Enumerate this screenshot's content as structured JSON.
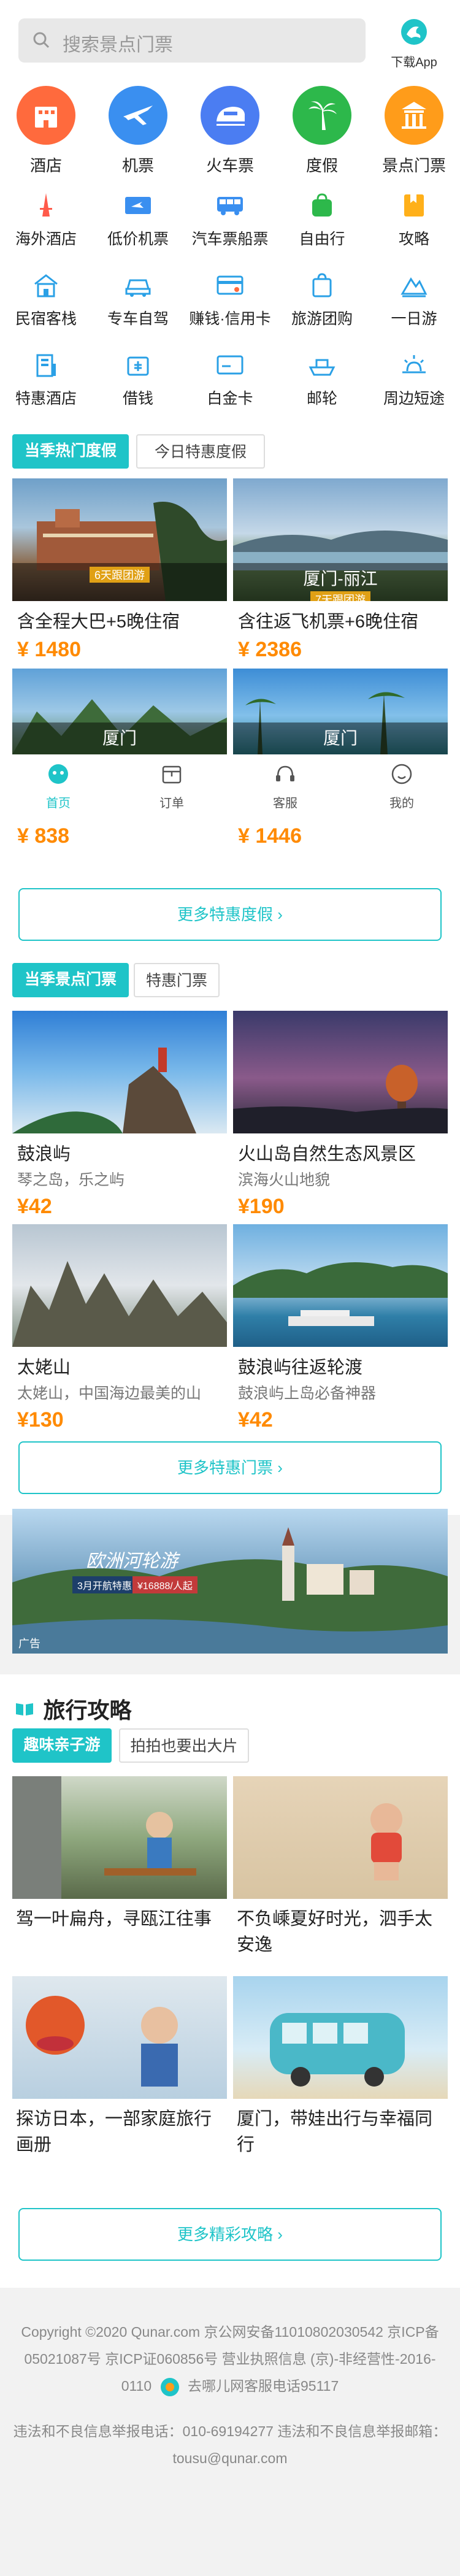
{
  "header": {
    "search_placeholder": "搜索景点门票",
    "download_label": "下载App"
  },
  "categories_big": [
    {
      "label": "酒店",
      "icon": "hotel-icon",
      "color": "#ff6a3d"
    },
    {
      "label": "机票",
      "icon": "plane-icon",
      "color": "#3a8ff0"
    },
    {
      "label": "火车票",
      "icon": "train-icon",
      "color": "#4b7df2"
    },
    {
      "label": "度假",
      "icon": "palm-tree-icon",
      "color": "#2db84b"
    },
    {
      "label": "景点门票",
      "icon": "temple-icon",
      "color": "#ff9c1a"
    }
  ],
  "categories_small": [
    {
      "label": "海外酒店",
      "icon": "tower-icon",
      "color": "#ff5a4a"
    },
    {
      "label": "低价机票",
      "icon": "ticket-icon",
      "color": "#3a8ff0"
    },
    {
      "label": "汽车票船票",
      "icon": "bus-icon",
      "color": "#3a8ff0"
    },
    {
      "label": "自由行",
      "icon": "bag-icon",
      "color": "#2db84b"
    },
    {
      "label": "攻略",
      "icon": "guide-icon",
      "color": "#ffb01a"
    },
    {
      "label": "民宿客栈",
      "icon": "house-icon",
      "color": "#2aa0e6"
    },
    {
      "label": "专车自驾",
      "icon": "car-icon",
      "color": "#2aa0e6"
    },
    {
      "label": "赚钱·信用卡",
      "icon": "card-icon",
      "color": "#2aa0e6"
    },
    {
      "label": "旅游团购",
      "icon": "shopping-bag-icon",
      "color": "#2aa0e6"
    },
    {
      "label": "一日游",
      "icon": "mountain-icon",
      "color": "#2aa0e6"
    },
    {
      "label": "特惠酒店",
      "icon": "building-icon",
      "color": "#2aa0e6"
    },
    {
      "label": "借钱",
      "icon": "wallet-icon",
      "color": "#2aa0e6"
    },
    {
      "label": "白金卡",
      "icon": "platinum-card-icon",
      "color": "#2aa0e6"
    },
    {
      "label": "邮轮",
      "icon": "ship-icon",
      "color": "#2aa0e6"
    },
    {
      "label": "周边短途",
      "icon": "sun-icon",
      "color": "#2aa0e6"
    }
  ],
  "vacation": {
    "tabs": [
      "当季热门度假",
      "今日特惠度假"
    ],
    "cards": [
      {
        "title": "含全程大巴+5晚住宿",
        "price": "¥ 1480",
        "dest": "",
        "tag": "6天跟团游"
      },
      {
        "title": "含往返飞机票+6晚住宿",
        "price": "¥ 2386",
        "dest": "厦门-丽江",
        "tag": "7天跟团游"
      },
      {
        "title": "",
        "price": "¥ 838",
        "dest": "厦门",
        "tag": ""
      },
      {
        "title": "",
        "price": "¥ 1446",
        "dest": "厦门",
        "tag": ""
      }
    ],
    "more": "更多特惠度假 ›"
  },
  "tabbar": [
    {
      "label": "首页",
      "icon": "home-icon"
    },
    {
      "label": "订单",
      "icon": "order-icon"
    },
    {
      "label": "客服",
      "icon": "headset-icon"
    },
    {
      "label": "我的",
      "icon": "user-icon"
    }
  ],
  "tickets": {
    "tabs": [
      "当季景点门票",
      "特惠门票"
    ],
    "cards": [
      {
        "title": "鼓浪屿",
        "sub": "琴之岛，乐之屿",
        "price": "¥42"
      },
      {
        "title": "火山岛自然生态风景区",
        "sub": "滨海火山地貌",
        "price": "¥190"
      },
      {
        "title": "太姥山",
        "sub": "太姥山，中国海边最美的山",
        "price": "¥130"
      },
      {
        "title": "鼓浪屿往返轮渡",
        "sub": "鼓浪屿上岛必备神器",
        "price": "¥42"
      }
    ],
    "more": "更多特惠门票 ›"
  },
  "ad": {
    "title": "欧洲河轮游",
    "date": "3月开航特惠",
    "price": "¥16888/人起",
    "tag": "广告"
  },
  "guide": {
    "title": "旅行攻略",
    "tabs": [
      "趣味亲子游",
      "拍拍也要出大片"
    ],
    "cards": [
      {
        "title": "驾一叶扁舟，寻瓯江往事"
      },
      {
        "title": "不负嵊夏好时光，泗手太安逸"
      },
      {
        "title": "探访日本，一部家庭旅行画册"
      },
      {
        "title": "厦门，带娃出行与幸福同行"
      }
    ],
    "more": "更多精彩攻略 ›"
  },
  "footer": {
    "line1": "Copyright ©2020 Qunar.com  京公网安备11010802030542  京ICP备05021087号  京ICP证060856号  营业执照信息  (京)-非经营性-2016-0110",
    "line1b": "去哪儿网客服电话95117",
    "line2": "违法和不良信息举报电话：010-69194277  违法和不良信息举报邮箱：tousu@qunar.com"
  }
}
